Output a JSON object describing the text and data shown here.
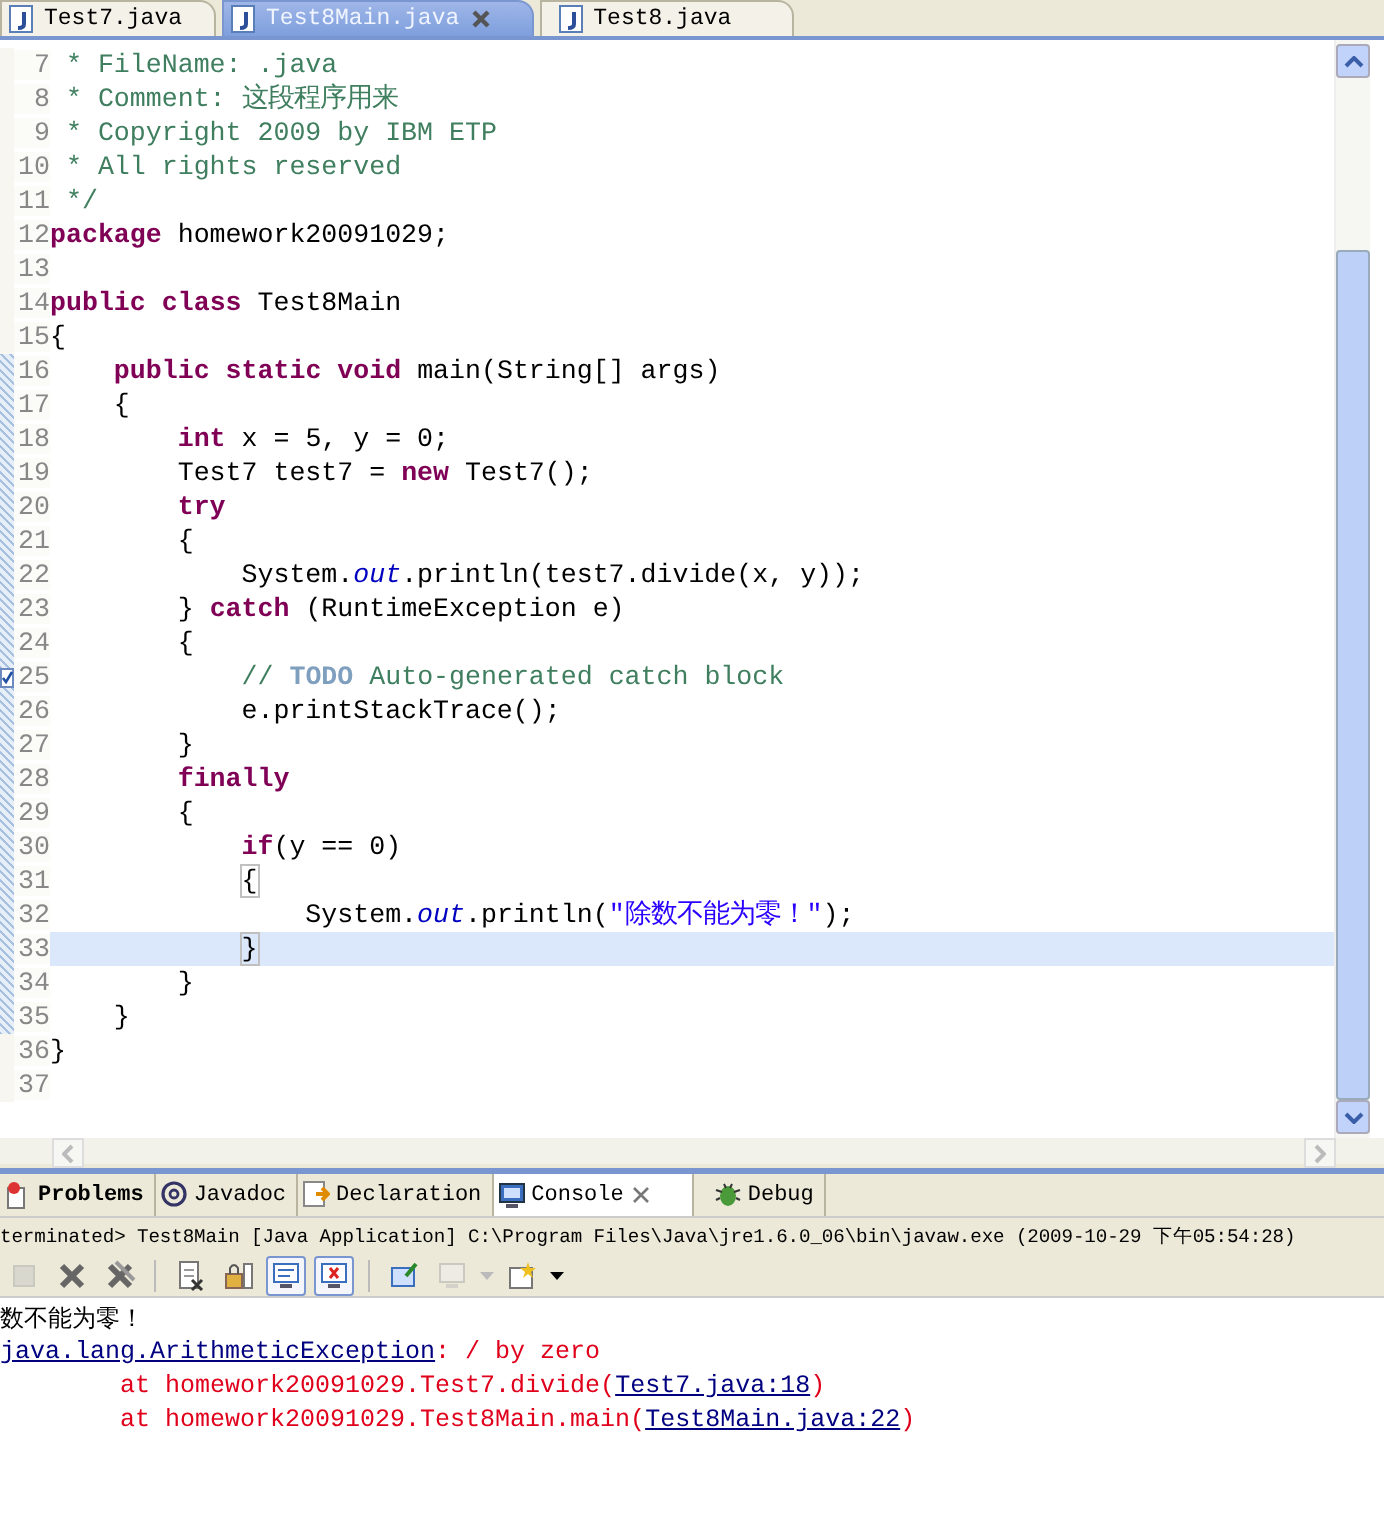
{
  "editor_tabs": [
    {
      "label": "Test7.java",
      "selected": false,
      "closable": false
    },
    {
      "label": "Test8Main.java",
      "selected": true,
      "closable": true
    },
    {
      "label": "Test8.java",
      "selected": false,
      "closable": false
    }
  ],
  "code_lines": [
    {
      "number": "7",
      "in_range": false,
      "current": false,
      "task": false,
      "tokens": [
        {
          "kind": "doc",
          "text": " * FileName: .java"
        }
      ]
    },
    {
      "number": "8",
      "in_range": false,
      "current": false,
      "task": false,
      "tokens": [
        {
          "kind": "doc",
          "text": " * Comment: 这段程序用来"
        }
      ]
    },
    {
      "number": "9",
      "in_range": false,
      "current": false,
      "task": false,
      "tokens": [
        {
          "kind": "doc",
          "text": " * Copyright 2009 by IBM ETP"
        }
      ]
    },
    {
      "number": "10",
      "in_range": false,
      "current": false,
      "task": false,
      "tokens": [
        {
          "kind": "doc",
          "text": " * All rights reserved"
        }
      ]
    },
    {
      "number": "11",
      "in_range": false,
      "current": false,
      "task": false,
      "tokens": [
        {
          "kind": "doc",
          "text": " */"
        }
      ]
    },
    {
      "number": "12",
      "in_range": false,
      "current": false,
      "task": false,
      "tokens": [
        {
          "kind": "keyword",
          "text": "package"
        },
        {
          "kind": "plain",
          "text": " homework20091029;"
        }
      ]
    },
    {
      "number": "13",
      "in_range": false,
      "current": false,
      "task": false
    },
    {
      "number": "14",
      "in_range": false,
      "current": false,
      "task": false,
      "tokens": [
        {
          "kind": "keyword",
          "text": "public"
        },
        {
          "kind": "keyword",
          "text": " class"
        },
        {
          "kind": "plain",
          "text": " Test8Main"
        }
      ]
    },
    {
      "number": "15",
      "in_range": false,
      "current": false,
      "task": false,
      "tokens": [
        {
          "kind": "plain",
          "text": "{"
        }
      ]
    },
    {
      "number": "16",
      "in_range": true,
      "current": false,
      "task": false,
      "tokens": [
        {
          "kind": "keyword",
          "text": "    public"
        },
        {
          "kind": "keyword",
          "text": " static"
        },
        {
          "kind": "keyword",
          "text": " void"
        },
        {
          "kind": "plain",
          "text": " main(String[] args)"
        }
      ]
    },
    {
      "number": "17",
      "in_range": true,
      "current": false,
      "task": false,
      "tokens": [
        {
          "kind": "plain",
          "text": "    {"
        }
      ]
    },
    {
      "number": "18",
      "in_range": true,
      "current": false,
      "task": false,
      "tokens": [
        {
          "kind": "keyword",
          "text": "        int"
        },
        {
          "kind": "plain",
          "text": " x = 5, y = 0;"
        }
      ]
    },
    {
      "number": "19",
      "in_range": true,
      "current": false,
      "task": false,
      "tokens": [
        {
          "kind": "plain",
          "text": "        Test7 test7 = "
        },
        {
          "kind": "keyword",
          "text": "new"
        },
        {
          "kind": "plain",
          "text": " Test7();"
        }
      ]
    },
    {
      "number": "20",
      "in_range": true,
      "current": false,
      "task": false,
      "tokens": [
        {
          "kind": "keyword",
          "text": "        try"
        }
      ]
    },
    {
      "number": "21",
      "in_range": true,
      "current": false,
      "task": false,
      "tokens": [
        {
          "kind": "plain",
          "text": "        {"
        }
      ]
    },
    {
      "number": "22",
      "in_range": true,
      "current": false,
      "task": false,
      "tokens": [
        {
          "kind": "plain",
          "text": "            System."
        },
        {
          "kind": "field",
          "text": "out"
        },
        {
          "kind": "plain",
          "text": ".println(test7.divide(x, y));"
        }
      ]
    },
    {
      "number": "23",
      "in_range": true,
      "current": false,
      "task": false,
      "tokens": [
        {
          "kind": "plain",
          "text": "        }"
        },
        {
          "kind": "keyword",
          "text": " catch"
        },
        {
          "kind": "plain",
          "text": " (RuntimeException e)"
        }
      ]
    },
    {
      "number": "24",
      "in_range": true,
      "current": false,
      "task": false,
      "tokens": [
        {
          "kind": "plain",
          "text": "        {"
        }
      ]
    },
    {
      "number": "25",
      "in_range": true,
      "current": false,
      "task": true,
      "tokens": [
        {
          "kind": "comment",
          "text": "            // "
        },
        {
          "kind": "task",
          "text": "TODO"
        },
        {
          "kind": "comment",
          "text": " Auto-generated catch block"
        }
      ]
    },
    {
      "number": "26",
      "in_range": true,
      "current": false,
      "task": false,
      "tokens": [
        {
          "kind": "plain",
          "text": "            e.printStackTrace();"
        }
      ]
    },
    {
      "number": "27",
      "in_range": true,
      "current": false,
      "task": false,
      "tokens": [
        {
          "kind": "plain",
          "text": "        }"
        }
      ]
    },
    {
      "number": "28",
      "in_range": true,
      "current": false,
      "task": false,
      "tokens": [
        {
          "kind": "keyword",
          "text": "        finally"
        }
      ]
    },
    {
      "number": "29",
      "in_range": true,
      "current": false,
      "task": false,
      "tokens": [
        {
          "kind": "plain",
          "text": "        {"
        }
      ]
    },
    {
      "number": "30",
      "in_range": true,
      "current": false,
      "task": false,
      "tokens": [
        {
          "kind": "keyword",
          "text": "            if"
        },
        {
          "kind": "plain",
          "text": "(y == 0)"
        }
      ]
    },
    {
      "number": "31",
      "in_range": true,
      "current": false,
      "task": false,
      "tokens": [
        {
          "kind": "bracket",
          "text": "            {"
        }
      ]
    },
    {
      "number": "32",
      "in_range": true,
      "current": false,
      "task": false,
      "tokens": [
        {
          "kind": "plain",
          "text": "                System."
        },
        {
          "kind": "field",
          "text": "out"
        },
        {
          "kind": "plain",
          "text": ".println("
        },
        {
          "kind": "string",
          "text": "\"除数不能为零！\""
        },
        {
          "kind": "plain",
          "text": ");"
        }
      ]
    },
    {
      "number": "33",
      "in_range": true,
      "current": true,
      "task": false,
      "tokens": [
        {
          "kind": "bracket",
          "text": "            }"
        }
      ]
    },
    {
      "number": "34",
      "in_range": true,
      "current": false,
      "task": false,
      "tokens": [
        {
          "kind": "plain",
          "text": "        }"
        }
      ]
    },
    {
      "number": "35",
      "in_range": true,
      "current": false,
      "task": false,
      "tokens": [
        {
          "kind": "plain",
          "text": "    }"
        }
      ]
    },
    {
      "number": "36",
      "in_range": false,
      "current": false,
      "task": false,
      "tokens": [
        {
          "kind": "plain",
          "text": "}"
        }
      ]
    },
    {
      "number": "37",
      "in_range": false,
      "current": false,
      "task": false
    }
  ],
  "bottom_tabs": [
    {
      "label": "Problems",
      "kind": "problems",
      "selected": false,
      "closable": false
    },
    {
      "label": "Javadoc",
      "kind": "javadoc",
      "selected": false,
      "closable": false
    },
    {
      "label": "Declaration",
      "kind": "declaration",
      "selected": false,
      "closable": false
    },
    {
      "label": "Console",
      "kind": "console",
      "selected": true,
      "closable": true
    },
    {
      "label": "Debug",
      "kind": "debug",
      "selected": false,
      "closable": false
    }
  ],
  "console": {
    "status": "terminated> Test8Main [Java Application] C:\\Program Files\\Java\\jre1.6.0_06\\bin\\javaw.exe (2009-10-29 下午05:54:28)",
    "toolbar": [
      {
        "kind": "terminate",
        "disabled": true,
        "pressed": false
      },
      {
        "kind": "remove",
        "disabled": false,
        "pressed": false
      },
      {
        "kind": "remove-all",
        "disabled": false,
        "pressed": false
      },
      {
        "kind": "separator"
      },
      {
        "kind": "clear",
        "disabled": false,
        "pressed": false
      },
      {
        "kind": "scroll-lock",
        "disabled": false,
        "pressed": false
      },
      {
        "kind": "show-out",
        "disabled": false,
        "pressed": true
      },
      {
        "kind": "show-err",
        "disabled": false,
        "pressed": true
      },
      {
        "kind": "separator"
      },
      {
        "kind": "pin",
        "disabled": false,
        "pressed": false
      },
      {
        "kind": "display",
        "disabled": true,
        "pressed": false
      },
      {
        "kind": "new-console",
        "disabled": false,
        "pressed": false
      }
    ],
    "output": [
      {
        "tokens": [
          {
            "kind": "stdout",
            "text": "数不能为零！"
          }
        ]
      },
      {
        "tokens": [
          {
            "kind": "link",
            "text": "java.lang.ArithmeticException"
          },
          {
            "kind": "error",
            "text": ": / by zero"
          }
        ]
      },
      {
        "tokens": [
          {
            "kind": "error",
            "text": "        at homework20091029.Test7.divide("
          },
          {
            "kind": "link",
            "text": "Test7.java:18"
          },
          {
            "kind": "error",
            "text": ")"
          }
        ]
      },
      {
        "tokens": [
          {
            "kind": "error",
            "text": "        at homework20091029.Test8Main.main("
          },
          {
            "kind": "link",
            "text": "Test8Main.java:22"
          },
          {
            "kind": "error",
            "text": ")"
          }
        ]
      }
    ]
  }
}
